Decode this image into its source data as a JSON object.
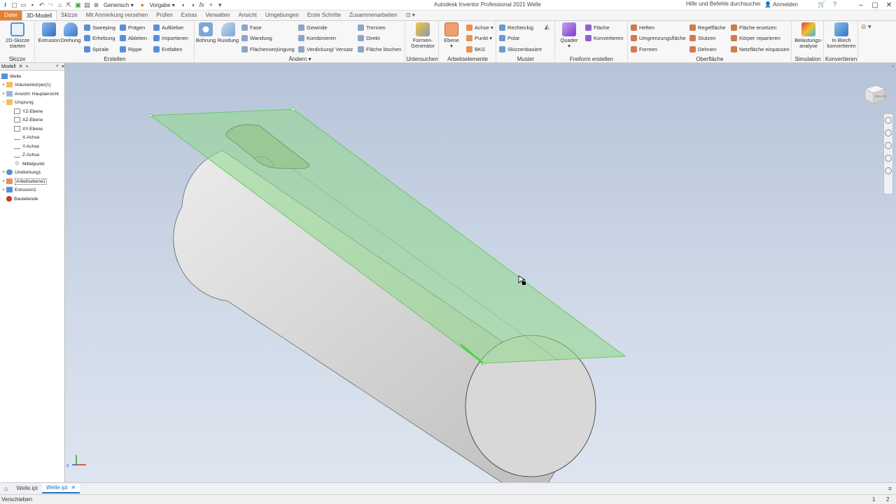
{
  "qat": {
    "style_select": "Generisch",
    "appearance_select": "Vorgabe"
  },
  "app_title": "Autodesk Inventor Professional 2021   Welle",
  "help_search": {
    "placeholder": "Hilfe und Befehle durchsuchen..."
  },
  "login": "Anmelden",
  "tabs": [
    "Datei",
    "3D-Modell",
    "Skizze",
    "Mit Anmerkung versehen",
    "Prüfen",
    "Extras",
    "Verwalten",
    "Ansicht",
    "Umgebungen",
    "Erste Schritte",
    "Zusammenarbeiten"
  ],
  "ribbon": {
    "skizze": {
      "label": "Skizze",
      "btn": "2D-Skizze starten"
    },
    "erstellen": {
      "label": "Erstellen",
      "big": [
        "Extrusion",
        "Drehung"
      ],
      "col1": [
        "Sweeping",
        "Erhebung",
        "Spirale"
      ],
      "col2": [
        "Prägen",
        "Ableiten",
        "Rippe"
      ],
      "col3": [
        "Aufkleber",
        "Importieren",
        "Entfalten"
      ]
    },
    "aendern": {
      "label": "Ändern",
      "big": [
        "Bohrung",
        "Rundung"
      ],
      "col1": [
        "Fase",
        "Wandung",
        "Flächenverjüngung"
      ],
      "col2": [
        "Gewinde",
        "Kombinieren",
        "Verdickung/ Versatz"
      ],
      "col3": [
        "Trennen",
        "Direkt",
        "Fläche löschen"
      ]
    },
    "untersuchen": {
      "label": "Untersuchen",
      "btn": "Formen-Generator"
    },
    "arbeitselemente": {
      "label": "Arbeitselemente",
      "btn": "Ebene",
      "col": [
        "Achse",
        "Punkt",
        "BKS"
      ]
    },
    "muster": {
      "label": "Muster",
      "col": [
        "Rechteckig",
        "Polar",
        "Skizzenbasiert"
      ]
    },
    "freiform": {
      "label": "Freiform erstellen",
      "btn": "Quader",
      "col": [
        "Fläche",
        "Konvertieren"
      ]
    },
    "oberflaeche": {
      "label": "Oberfläche",
      "col1": [
        "Heften",
        "Umgrenzungsfläche",
        "Formen"
      ],
      "col2": [
        "Regelfläche",
        "Stutzen",
        "Dehnen"
      ],
      "col3": [
        "Fläche ersetzen",
        "Körper reparieren",
        "Netzfläche einpassen"
      ]
    },
    "simulation": {
      "label": "Simulation",
      "btn": "Belastungs-analyse"
    },
    "konvertieren": {
      "label": "Konvertieren",
      "btn": "In Blech konvertieren"
    }
  },
  "browser": {
    "tab": "Modell",
    "items": [
      {
        "label": "Welle",
        "icon": "part-icon"
      },
      {
        "label": "Volumenkörper(1)",
        "icon": "solid-bodies-icon"
      },
      {
        "label": "Ansicht: Hauptansicht",
        "icon": "view-icon"
      },
      {
        "label": "Ursprung",
        "icon": "folder-icon"
      },
      {
        "label": "YZ-Ebene",
        "icon": "plane-icon"
      },
      {
        "label": "XZ-Ebene",
        "icon": "plane-icon"
      },
      {
        "label": "XY-Ebene",
        "icon": "plane-icon"
      },
      {
        "label": "X-Achse",
        "icon": "axis-icon"
      },
      {
        "label": "Y-Achse",
        "icon": "axis-icon"
      },
      {
        "label": "Z-Achse",
        "icon": "axis-icon"
      },
      {
        "label": "Mittelpunkt",
        "icon": "point-icon"
      },
      {
        "label": "Umdrehung1",
        "icon": "revolve-icon"
      },
      {
        "label": "Arbeitsebene1",
        "icon": "workplane-icon"
      },
      {
        "label": "Extrusion1",
        "icon": "extrude-icon"
      },
      {
        "label": "Bauteilende",
        "icon": "end-of-part-icon"
      }
    ]
  },
  "viewcube_label": "RECHTS",
  "doc_tabs": [
    "Welle.ipt",
    "Welle.ipt"
  ],
  "status": {
    "text": "Verschieben",
    "n1": "1",
    "n2": "2"
  },
  "colors": {
    "file_tab": "#e8802f",
    "workplane": "#8fd88a",
    "accent": "#1a73c8"
  }
}
